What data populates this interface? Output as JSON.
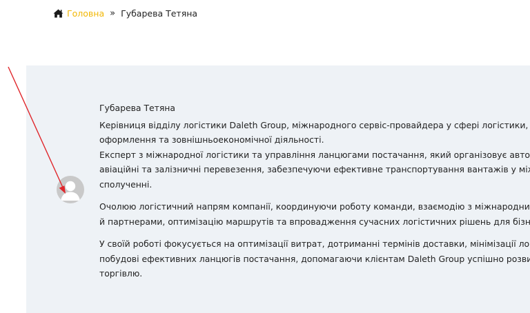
{
  "breadcrumb": {
    "home_icon": "home-icon",
    "home_label": "Головна",
    "separator": "»",
    "current": "Губарева Тетяна"
  },
  "profile": {
    "avatar_icon": "user-avatar-placeholder-icon",
    "name": "Губарева Тетяна",
    "paragraph1": {
      "line1": "Керівниця відділу логістики Daleth Group, міжнародного сервіс-провайдера у сфері логістики, митно",
      "line2": "оформлення та зовнішньоекономічної діяльності.",
      "line3": "Експерт з міжнародної логістики та управління ланцюгами постачання, який організовує автомобіл",
      "line4": "авіаційні та залізничні перевезення, забезпечуючи ефективне транспортування вантажів у міжнаро",
      "line5": "сполученні."
    },
    "paragraph2": {
      "line1": "Очолюю логістичний напрям компанії, координуючи роботу команди, взаємодію з міжнародними п",
      "line2": "й партнерами, оптимізацію маршрутів та впровадження сучасних логістичних рішень для бізнесу."
    },
    "paragraph3": {
      "line1": "У своїй роботі фокусується на оптимізації витрат, дотриманні термінів доставки, мінімізації логістич",
      "line2": "побудові ефективних ланцюгів постачання, допомагаючи клієнтам Daleth Group успішно розвивати",
      "line3": "торгівлю."
    }
  },
  "colors": {
    "accent": "#f2b705",
    "panel_bg": "#eef2f6",
    "text": "#222222",
    "annotation_arrow": "#e0262b"
  }
}
